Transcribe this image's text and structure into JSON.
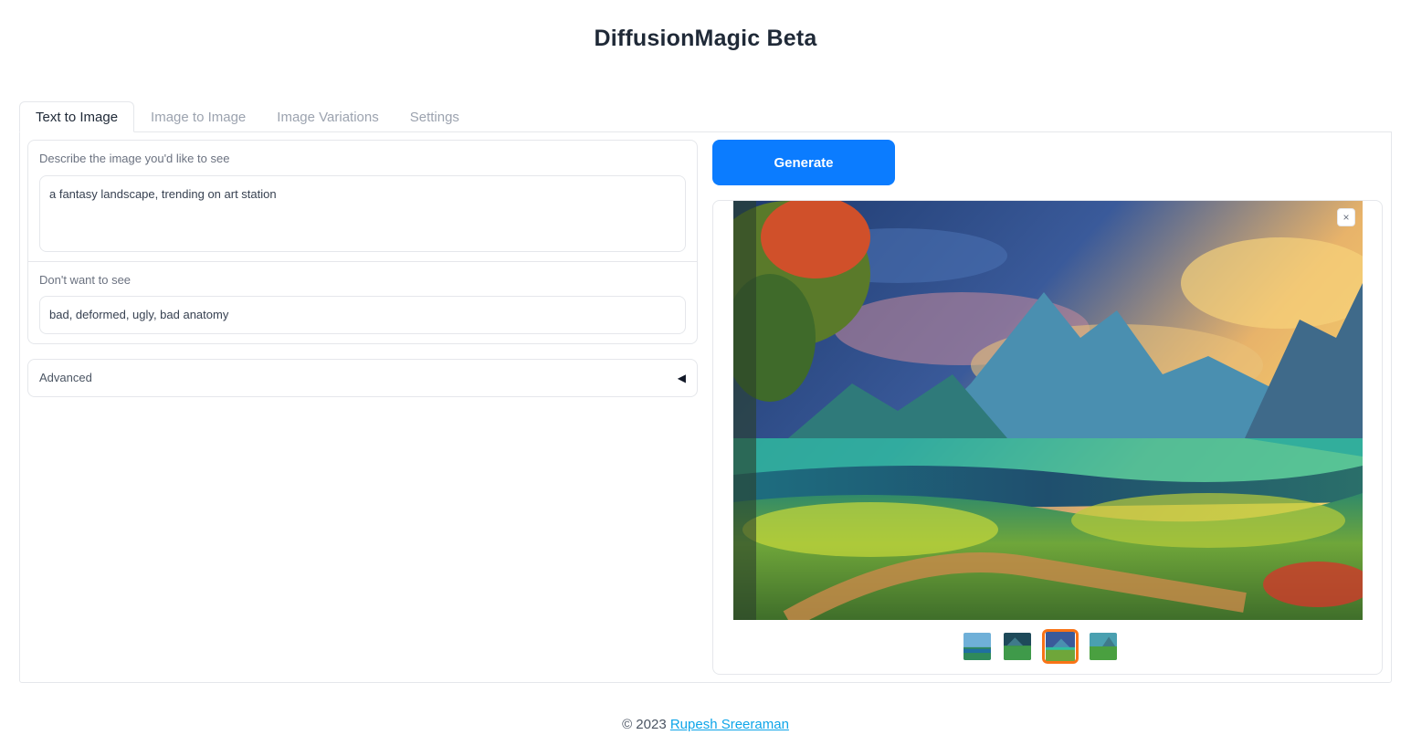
{
  "app": {
    "title": "DiffusionMagic Beta"
  },
  "tabs": [
    {
      "label": "Text to Image",
      "active": true
    },
    {
      "label": "Image to Image",
      "active": false
    },
    {
      "label": "Image Variations",
      "active": false
    },
    {
      "label": "Settings",
      "active": false
    }
  ],
  "prompt": {
    "label": "Describe the image you'd like to see",
    "value": "a fantasy landscape, trending on art station"
  },
  "negative_prompt": {
    "label": "Don't want to see",
    "value": "bad, deformed, ugly, bad anatomy"
  },
  "advanced": {
    "label": "Advanced",
    "caret_icon": "triangle-left-icon"
  },
  "generate": {
    "label": "Generate",
    "color": "#0b7cff"
  },
  "gallery": {
    "close_label": "×",
    "selected_index": 2,
    "thumbnail_count": 4,
    "selected_border_color": "#f97316"
  },
  "footer": {
    "copyright": "© 2023",
    "author_link": "Rupesh Sreeraman"
  }
}
